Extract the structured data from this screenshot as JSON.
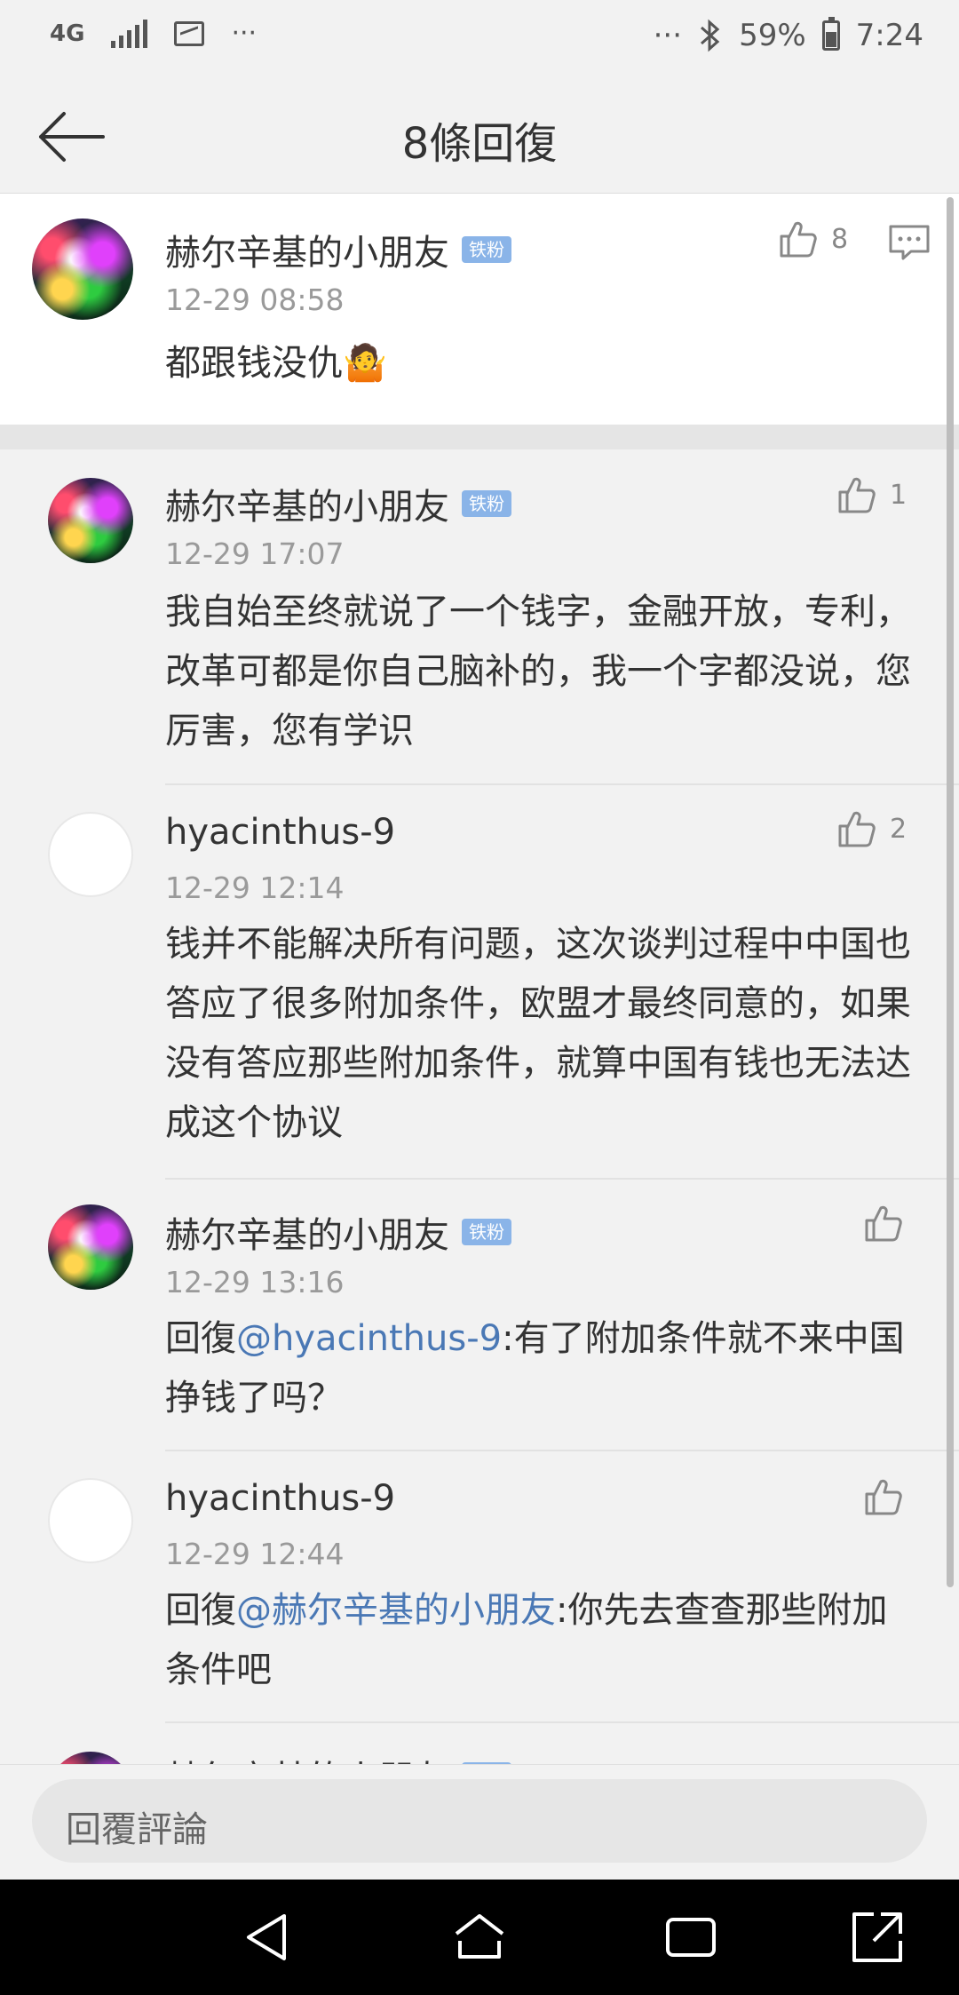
{
  "status_bar": {
    "network": "4G",
    "overflow_left": "···",
    "overflow_right": "···",
    "battery": "59%",
    "battery_level": 0.59,
    "time": "7:24"
  },
  "header": {
    "title": "8條回復"
  },
  "main_comment": {
    "username": "赫尔辛基的小朋友",
    "badge": "铁粉",
    "time": "12-29 08:58",
    "text": "都跟钱没仇🤷",
    "likes": "8"
  },
  "replies": [
    {
      "username": "赫尔辛基的小朋友",
      "badge": "铁粉",
      "time": "12-29 17:07",
      "text": "我自始至终就说了一个钱字，金融开放，专利，改革可都是你自己脑补的，我一个字都没说，您厉害，您有学识",
      "likes": "1"
    },
    {
      "username": "hyacinthus-9",
      "badge": "",
      "time": "12-29 12:14",
      "text": "钱并不能解决所有问题，这次谈判过程中中国也答应了很多附加条件，欧盟才最终同意的，如果没有答应那些附加条件，就算中国有钱也无法达成这个协议",
      "likes": "2"
    },
    {
      "username": "赫尔辛基的小朋友",
      "badge": "铁粉",
      "time": "12-29 13:16",
      "reply_prefix": "回復",
      "mention": "@hyacinthus-9",
      "text": ":有了附加条件就不来中国挣钱了吗？",
      "likes": ""
    },
    {
      "username": "hyacinthus-9",
      "badge": "",
      "time": "12-29 12:44",
      "reply_prefix": "回復",
      "mention": "@赫尔辛基的小朋友",
      "text": ":你先去查查那些附加条件吧",
      "likes": ""
    },
    {
      "username": "赫尔辛基的小朋友",
      "badge": "铁粉"
    }
  ],
  "input": {
    "placeholder": "回覆評論"
  }
}
